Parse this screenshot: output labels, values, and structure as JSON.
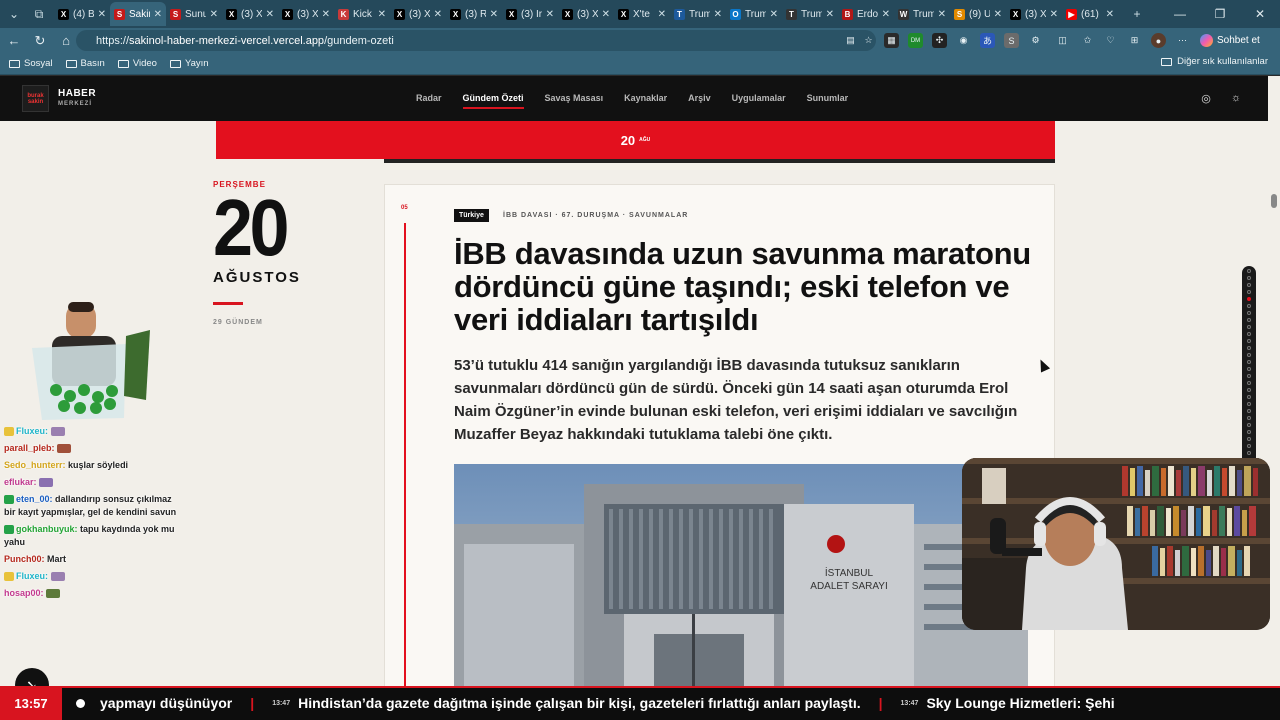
{
  "browser": {
    "tabs": [
      {
        "title": "(4) B",
        "fav": "X",
        "color": "#000"
      },
      {
        "title": "Sakin",
        "fav": "S",
        "color": "#c51a1a"
      },
      {
        "title": "Sunu",
        "fav": "S",
        "color": "#c51a1a"
      },
      {
        "title": "(3) X",
        "fav": "X",
        "color": "#000"
      },
      {
        "title": "(3) X",
        "fav": "X",
        "color": "#000"
      },
      {
        "title": "Kick",
        "fav": "K",
        "color": "#c83a3a"
      },
      {
        "title": "(3) X",
        "fav": "X",
        "color": "#000"
      },
      {
        "title": "(3) R",
        "fav": "X",
        "color": "#000"
      },
      {
        "title": "(3) Ir",
        "fav": "X",
        "color": "#000"
      },
      {
        "title": "(3) X",
        "fav": "X",
        "color": "#000"
      },
      {
        "title": "X'te",
        "fav": "X",
        "color": "#000"
      },
      {
        "title": "Trum",
        "fav": "T",
        "color": "#1d5a9c"
      },
      {
        "title": "Trum",
        "fav": "O",
        "color": "#0a77c9"
      },
      {
        "title": "Trum",
        "fav": "T",
        "color": "#333"
      },
      {
        "title": "Erdo",
        "fav": "B",
        "color": "#b01717"
      },
      {
        "title": "Trum",
        "fav": "W",
        "color": "#333"
      },
      {
        "title": "(9) U",
        "fav": "S",
        "color": "#e18a00"
      },
      {
        "title": "(3) X",
        "fav": "X",
        "color": "#000"
      },
      {
        "title": "(61)",
        "fav": "▶",
        "color": "#e00"
      }
    ],
    "active_tab_index": 1,
    "url_prefix": "https://",
    "url_host": "sakinol-haber-merkezi-vercel.vercel.app",
    "url_path": "/gundem-ozeti",
    "copilot_label": "Sohbet et",
    "bookmarks": [
      "Sosyal",
      "Basın",
      "Video",
      "Yayın"
    ],
    "other_bookmarks": "Diğer sık kullanılanlar"
  },
  "site": {
    "logo_badge": "burak sakin",
    "logo_title": "HABER",
    "logo_sub": "MERKEZİ",
    "menu": [
      "Radar",
      "Gündem Özeti",
      "Savaş Masası",
      "Kaynaklar",
      "Arşiv",
      "Uygulamalar",
      "Sunumlar"
    ],
    "menu_active_index": 1,
    "date_bar_day": "20",
    "date_bar_month": "AĞU",
    "left": {
      "weekday": "PERŞEMBE",
      "day": "20",
      "month": "AĞUSTOS",
      "count": "29 GÜNDEM"
    },
    "article": {
      "number": "05",
      "tag": "Türkiye",
      "meta": "İBB DAVASI · 67. DURUŞMA · SAVUNMALAR",
      "headline": "İBB davasında uzun savunma maratonu dördüncü güne taşındı; eski telefon ve veri iddiaları tartışıldı",
      "lead": "53’ü tutuklu 414 sanığın yargılandığı İBB davasında tutuksuz sanıkların savunmaları dördüncü gün de sürdü. Önceki gün 14 saati aşan oturumda Erol Naim Özgüner’in evinde bulunan eski telefon, veri erişimi iddiaları ve savcılığın Muzaffer Beyaz hakkındaki tutuklama talebi öne çıktı.",
      "photo_sign_1": "İSTANBUL",
      "photo_sign_2": "ADALET SARAYI"
    }
  },
  "chat": [
    {
      "user": "Fluxeu:",
      "text": "",
      "color": "#21b5c9",
      "badge": "#e8c23a",
      "emote": "#9a7fb0"
    },
    {
      "user": "parall_pleb:",
      "text": "",
      "color": "#b5281c",
      "badge": "",
      "emote": "#a0503a"
    },
    {
      "user": "Sedo_hunterr:",
      "text": "kuşlar söyledi",
      "color": "#d3a51d",
      "badge": "",
      "emote": ""
    },
    {
      "user": "eflukar:",
      "text": "",
      "color": "#c03a8e",
      "badge": "",
      "emote": "#8a70b0"
    },
    {
      "user": "eten_00:",
      "text": "dallandırıp sonsuz çıkılmaz bir kayıt yapmışlar, gel de kendini savun",
      "color": "#1b5fc2",
      "badge": "#24a148",
      "emote": ""
    },
    {
      "user": "gokhanbuyuk:",
      "text": "tapu kaydında yok mu yahu",
      "color": "#23a334",
      "badge": "#24a148",
      "emote": ""
    },
    {
      "user": "Punch00:",
      "text": "Mart",
      "color": "#b5281c",
      "badge": "",
      "emote": ""
    },
    {
      "user": "Fluxeu:",
      "text": "",
      "color": "#21b5c9",
      "badge": "#e8c23a",
      "emote": "#9a7fb0"
    },
    {
      "user": "hosap00:",
      "text": "",
      "color": "#c33a8e",
      "badge": "",
      "emote": "#5d7a3a"
    }
  ],
  "ticker": {
    "clock": "13:57",
    "items": [
      {
        "time": "",
        "text": "yapmayı düşünüyor"
      },
      {
        "time": "13:47",
        "text": "Hindistan’da gazete dağıtma işinde çalışan bir kişi, gazeteleri fırlattığı anları paylaştı."
      },
      {
        "time": "13:47",
        "text": "Sky Lounge Hizmetleri: Şehi"
      }
    ]
  },
  "icons": {
    "back": "back-arrow-icon",
    "reload": "reload-icon",
    "home": "home-icon",
    "settings": "gear-icon",
    "theme": "sun-icon"
  },
  "colors": {
    "accent": "#e3101e",
    "chrome": "#36647a",
    "tabbar": "#25495b"
  }
}
